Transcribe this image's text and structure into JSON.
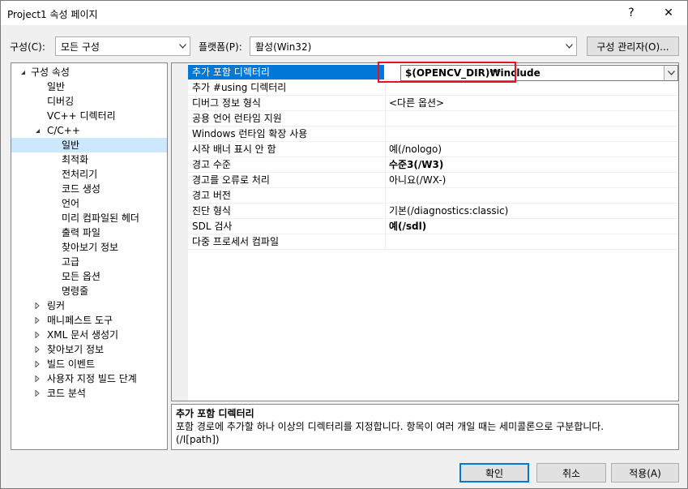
{
  "window": {
    "title": "Project1 속성 페이지",
    "help": "?",
    "close": "✕"
  },
  "toolbar": {
    "config_label": "구성(C):",
    "config_value": "모든 구성",
    "platform_label": "플랫폼(P):",
    "platform_value": "활성(Win32)",
    "config_manager": "구성 관리자(O)..."
  },
  "tree": [
    {
      "label": "구성 속성",
      "level": 0,
      "expander": "open"
    },
    {
      "label": "일반",
      "level": 1,
      "expander": "none"
    },
    {
      "label": "디버깅",
      "level": 1,
      "expander": "none"
    },
    {
      "label": "VC++ 디렉터리",
      "level": 1,
      "expander": "none"
    },
    {
      "label": "C/C++",
      "level": 1,
      "expander": "open"
    },
    {
      "label": "일반",
      "level": 2,
      "expander": "none",
      "selected": true
    },
    {
      "label": "최적화",
      "level": 2,
      "expander": "none"
    },
    {
      "label": "전처리기",
      "level": 2,
      "expander": "none"
    },
    {
      "label": "코드 생성",
      "level": 2,
      "expander": "none"
    },
    {
      "label": "언어",
      "level": 2,
      "expander": "none"
    },
    {
      "label": "미리 컴파일된 헤더",
      "level": 2,
      "expander": "none"
    },
    {
      "label": "출력 파일",
      "level": 2,
      "expander": "none"
    },
    {
      "label": "찾아보기 정보",
      "level": 2,
      "expander": "none"
    },
    {
      "label": "고급",
      "level": 2,
      "expander": "none"
    },
    {
      "label": "모든 옵션",
      "level": 2,
      "expander": "none"
    },
    {
      "label": "명령줄",
      "level": 2,
      "expander": "none"
    },
    {
      "label": "링커",
      "level": 1,
      "expander": "closed"
    },
    {
      "label": "매니페스트 도구",
      "level": 1,
      "expander": "closed"
    },
    {
      "label": "XML 문서 생성기",
      "level": 1,
      "expander": "closed"
    },
    {
      "label": "찾아보기 정보",
      "level": 1,
      "expander": "closed"
    },
    {
      "label": "빌드 이벤트",
      "level": 1,
      "expander": "closed"
    },
    {
      "label": "사용자 지정 빌드 단계",
      "level": 1,
      "expander": "closed"
    },
    {
      "label": "코드 분석",
      "level": 1,
      "expander": "closed"
    }
  ],
  "properties": [
    {
      "name": "추가 포함 디렉터리",
      "value": "$(OPENCV_DIR)₩include",
      "bold": true,
      "selected": true
    },
    {
      "name": "추가 #using 디렉터리",
      "value": "",
      "bold": false
    },
    {
      "name": "디버그 정보 형식",
      "value": "<다른 옵션>",
      "bold": false
    },
    {
      "name": "공용 언어 런타임 지원",
      "value": "",
      "bold": false
    },
    {
      "name": "Windows 런타임 확장 사용",
      "value": "",
      "bold": false
    },
    {
      "name": "시작 배너 표시 안 함",
      "value": "예(/nologo)",
      "bold": false
    },
    {
      "name": "경고 수준",
      "value": "수준3(/W3)",
      "bold": true
    },
    {
      "name": "경고를 오류로 처리",
      "value": "아니요(/WX-)",
      "bold": false
    },
    {
      "name": "경고 버전",
      "value": "",
      "bold": false
    },
    {
      "name": "진단 형식",
      "value": "기본(/diagnostics:classic)",
      "bold": false
    },
    {
      "name": "SDL 검사",
      "value": "예(/sdl)",
      "bold": true
    },
    {
      "name": "다중 프로세서 컴파일",
      "value": "",
      "bold": false
    }
  ],
  "description": {
    "title": "추가 포함 디렉터리",
    "body": "포함 경로에 추가할 하나 이상의 디렉터리를 지정합니다. 항목이 여러 개일 때는 세미콜론으로 구분합니다.",
    "switch": "(/I[path])"
  },
  "buttons": {
    "ok": "확인",
    "cancel": "취소",
    "apply": "적용(A)"
  },
  "colors": {
    "selection": "#0078d7",
    "tree_selection": "#cce8ff",
    "highlight_box": "#e81123"
  }
}
